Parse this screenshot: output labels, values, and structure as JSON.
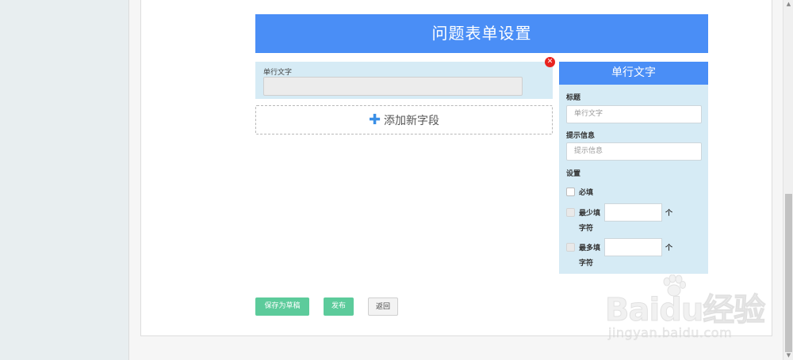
{
  "form": {
    "title": "问题表单设置",
    "field_label": "单行文字",
    "add_field_label": "添加新字段"
  },
  "props": {
    "panel_title": "单行文字",
    "title_label": "标题",
    "title_placeholder": "单行文字",
    "hint_label": "提示信息",
    "hint_placeholder": "提示信息",
    "settings_label": "设置",
    "required_label": "必填",
    "min_label_line1": "最少填",
    "min_label_line2": "字符",
    "max_label_line1": "最多填",
    "max_label_line2": "字符",
    "unit_label": "个"
  },
  "actions": {
    "save_draft": "保存为草稿",
    "publish": "发布",
    "back": "返回"
  },
  "watermark": {
    "logo": "Baidu经验",
    "url": "jingyan.baidu.com"
  },
  "icons": {
    "plus": "plus-icon",
    "delete": "close-circle-icon",
    "paw": "baidu-paw-icon"
  },
  "colors": {
    "primary": "#4a8ef6",
    "panel_bg": "#d6ebf5",
    "success": "#5ccb9b",
    "danger": "#e8231f"
  }
}
